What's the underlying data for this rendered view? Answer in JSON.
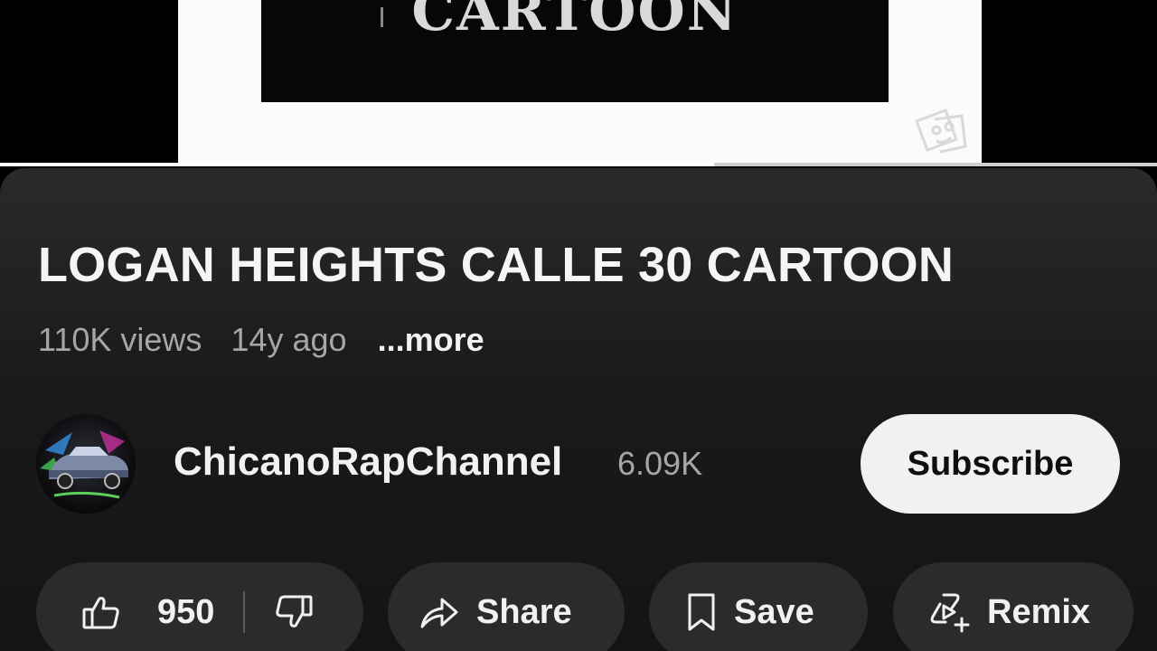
{
  "video": {
    "overlay_text": "CARTOON",
    "progress": 0.617
  },
  "title": "LOGAN HEIGHTS CALLE 30 CARTOON",
  "meta": {
    "views": "110K views",
    "age": "14y ago",
    "more": "...more"
  },
  "channel": {
    "name": "ChicanoRapChannel",
    "subscribers": "6.09K",
    "avatar_icon": "lowrider-car-avatar"
  },
  "subscribe_label": "Subscribe",
  "actions": {
    "like_count": "950",
    "like_icon": "thumbs-up-icon",
    "dislike_icon": "thumbs-down-icon",
    "share_label": "Share",
    "share_icon": "share-arrow-icon",
    "save_label": "Save",
    "save_icon": "bookmark-icon",
    "remix_label": "Remix",
    "remix_icon": "remix-icon"
  },
  "colors": {
    "background": "#000000",
    "panel": "#1f1f20",
    "pill": "#2b2b2d",
    "subscribe_bg": "#f1f1f1",
    "text_primary": "#f1f1f1",
    "text_secondary": "#a6a6a6"
  }
}
